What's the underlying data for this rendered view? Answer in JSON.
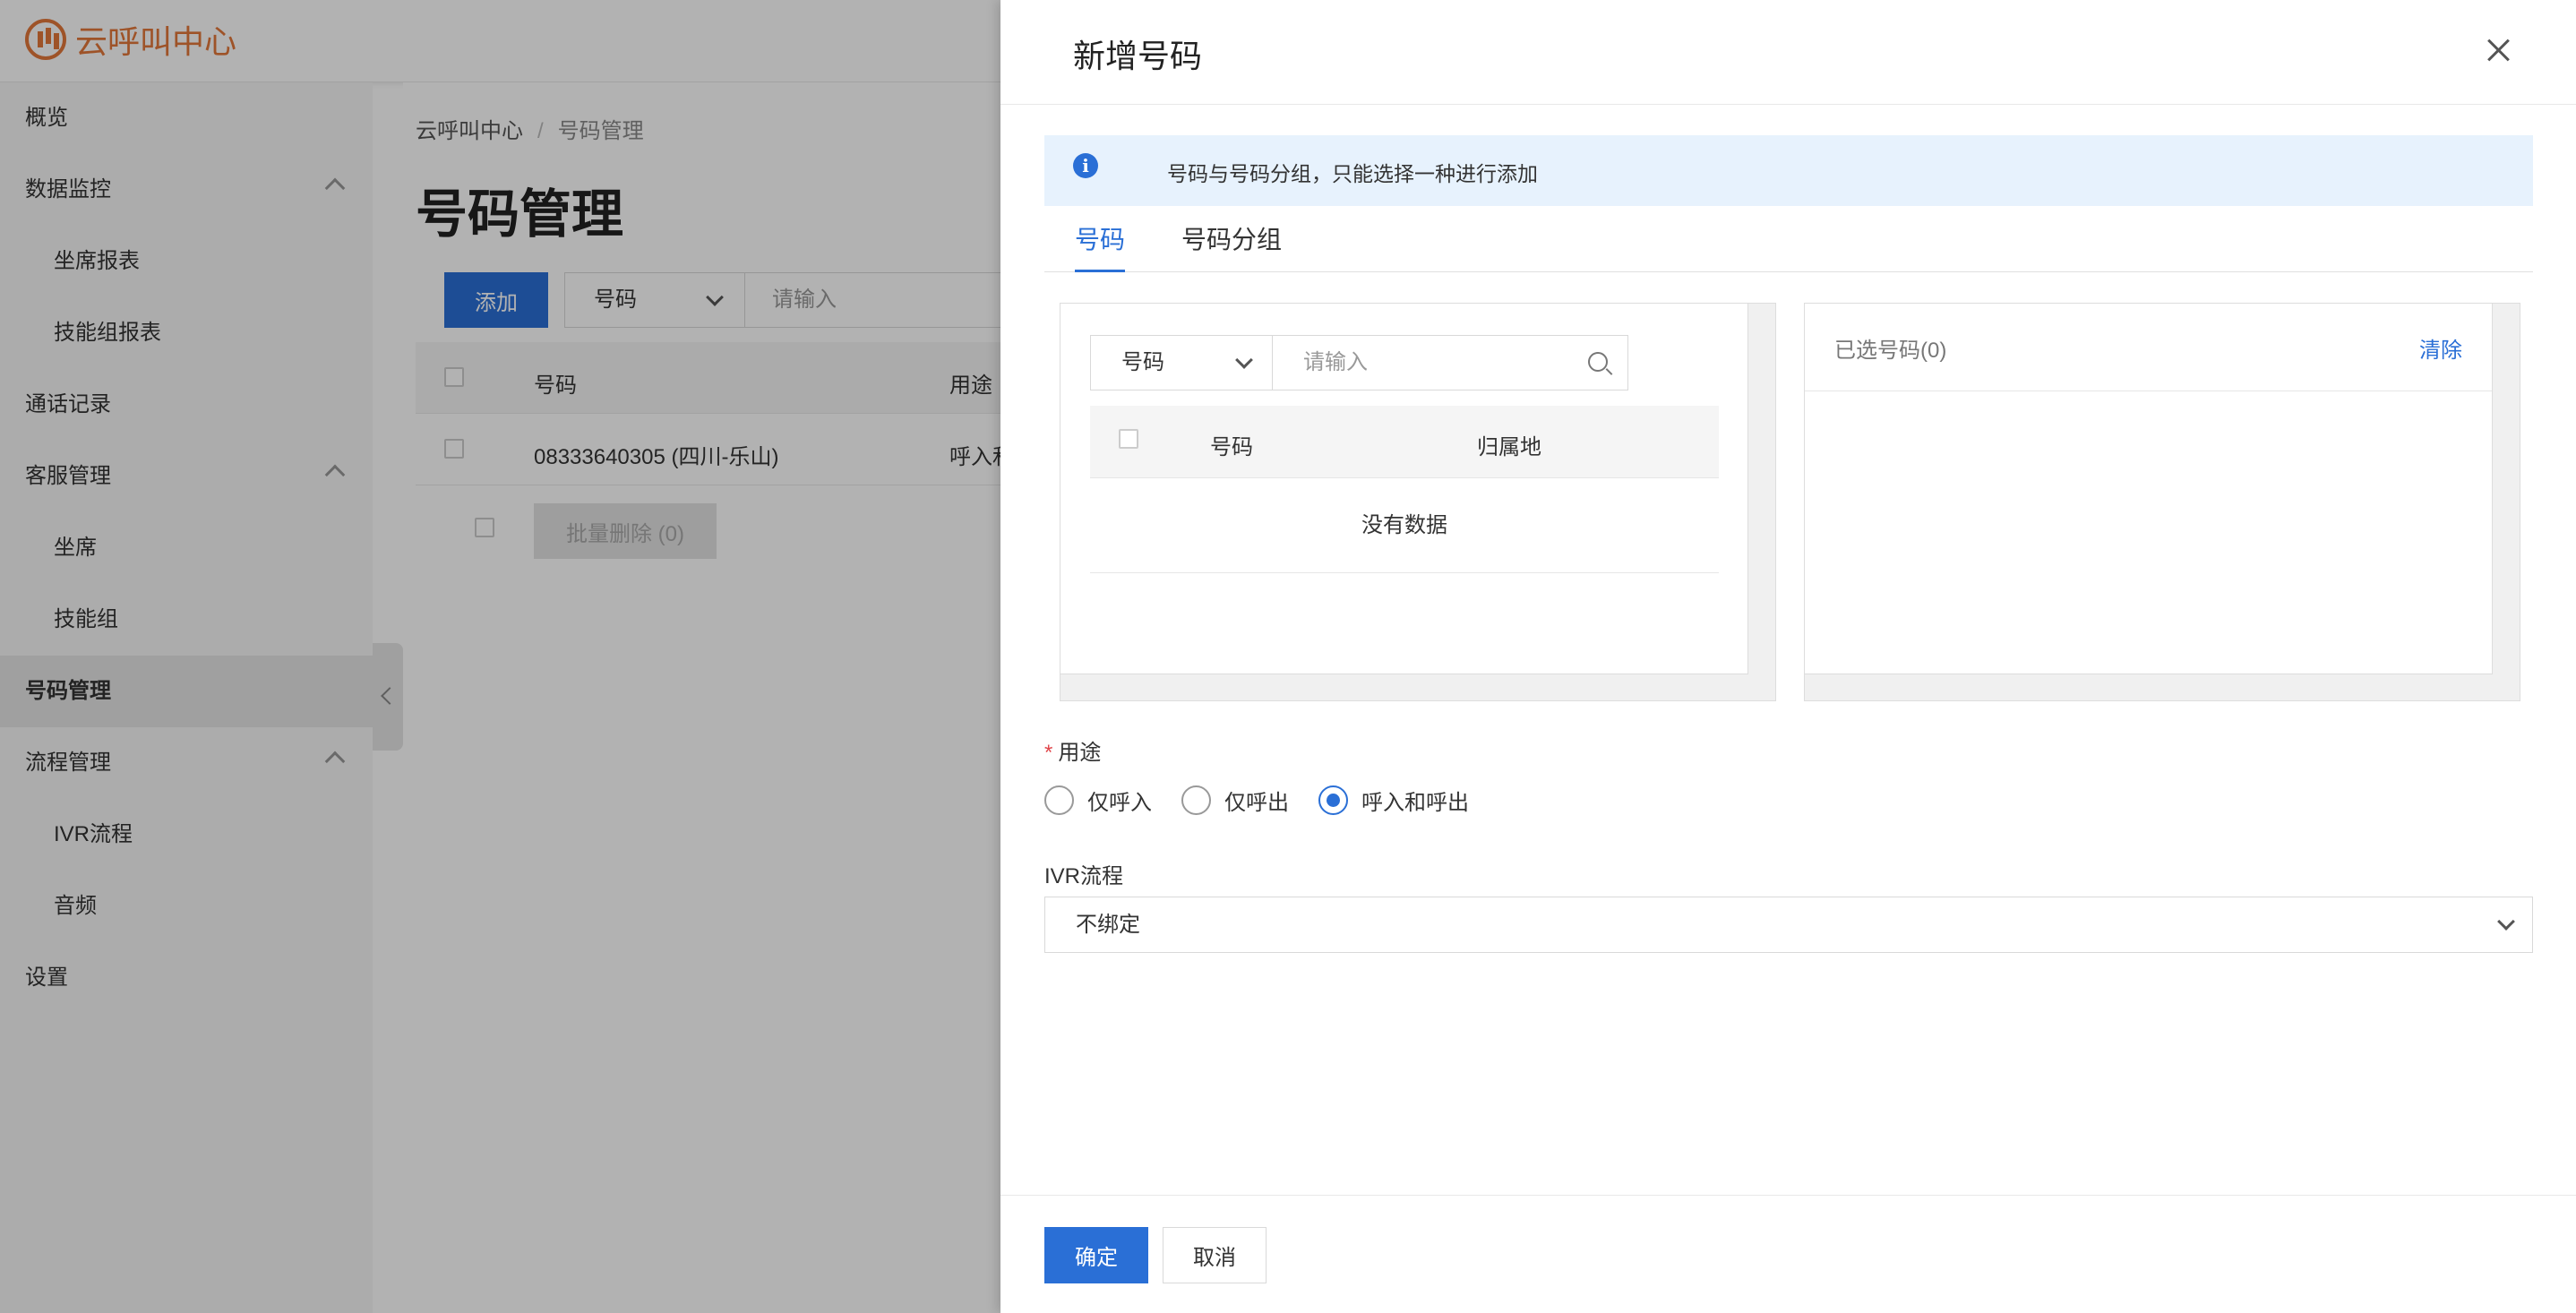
{
  "app": {
    "name": "云呼叫中心"
  },
  "sidebar": {
    "items": [
      {
        "label": "概览"
      },
      {
        "label": "数据监控"
      },
      {
        "label": "坐席报表"
      },
      {
        "label": "技能组报表"
      },
      {
        "label": "通话记录"
      },
      {
        "label": "客服管理"
      },
      {
        "label": "坐席"
      },
      {
        "label": "技能组"
      },
      {
        "label": "号码管理"
      },
      {
        "label": "流程管理"
      },
      {
        "label": "IVR流程"
      },
      {
        "label": "音频"
      },
      {
        "label": "设置"
      }
    ]
  },
  "breadcrumb": {
    "root": "云呼叫中心",
    "sep": "/",
    "current": "号码管理"
  },
  "page": {
    "title": "号码管理",
    "add_label": "添加",
    "filter_select": "号码",
    "filter_placeholder": "请输入",
    "table": {
      "headers": [
        "号码",
        "用途"
      ],
      "rows": [
        {
          "number": "08333640305 (四川-乐山)",
          "usage": "呼入和"
        }
      ]
    },
    "bulk_delete_label": "批量删除 (0)"
  },
  "drawer": {
    "title": "新增号码",
    "notice": "号码与号码分组，只能选择一种进行添加",
    "tabs": [
      "号码",
      "号码分组"
    ],
    "left_panel": {
      "select_value": "号码",
      "search_placeholder": "请输入",
      "headers": [
        "号码",
        "归属地"
      ],
      "empty_text": "没有数据"
    },
    "right_panel": {
      "title": "已选号码(0)",
      "clear_label": "清除"
    },
    "usage": {
      "label": "用途",
      "required_mark": "*",
      "options": [
        "仅呼入",
        "仅呼出",
        "呼入和呼出"
      ],
      "selected": "呼入和呼出"
    },
    "ivr": {
      "label": "IVR流程",
      "value": "不绑定"
    },
    "footer": {
      "ok_label": "确定",
      "cancel_label": "取消"
    }
  },
  "colors": {
    "primary": "#2a6fd6",
    "brand": "#e3773a",
    "notice_bg": "#e7f2fd",
    "required": "#e0454a"
  }
}
